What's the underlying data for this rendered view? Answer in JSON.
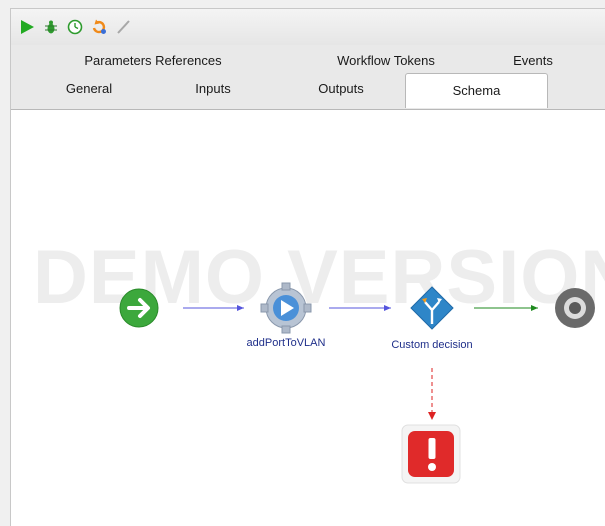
{
  "toolbar": {
    "buttons": [
      {
        "name": "run",
        "icon": "run-icon"
      },
      {
        "name": "debug",
        "icon": "debug-icon"
      },
      {
        "name": "schedule",
        "icon": "schedule-icon"
      },
      {
        "name": "refresh",
        "icon": "refresh-icon"
      },
      {
        "name": "edit",
        "icon": "edit-icon"
      }
    ]
  },
  "tabs": {
    "row1": [
      {
        "label": "Parameters References"
      },
      {
        "label": "Workflow Tokens"
      },
      {
        "label": "Events"
      }
    ],
    "row2": [
      {
        "label": "General"
      },
      {
        "label": "Inputs"
      },
      {
        "label": "Outputs"
      },
      {
        "label": "Schema",
        "selected": true
      }
    ]
  },
  "schema": {
    "watermark": "DEMO VERSION",
    "nodes": {
      "start": {
        "icon": "start-icon"
      },
      "task": {
        "label": "addPortToVLAN",
        "icon": "workflow-task-icon"
      },
      "decision": {
        "label": "Custom decision",
        "icon": "custom-decision-icon"
      },
      "end": {
        "icon": "end-icon"
      },
      "error": {
        "icon": "error-icon"
      }
    }
  },
  "colors": {
    "edge_default": "#5555dd",
    "edge_success": "#1e8a1e",
    "edge_error": "#dd2222",
    "node_label": "#1f2f8a"
  }
}
